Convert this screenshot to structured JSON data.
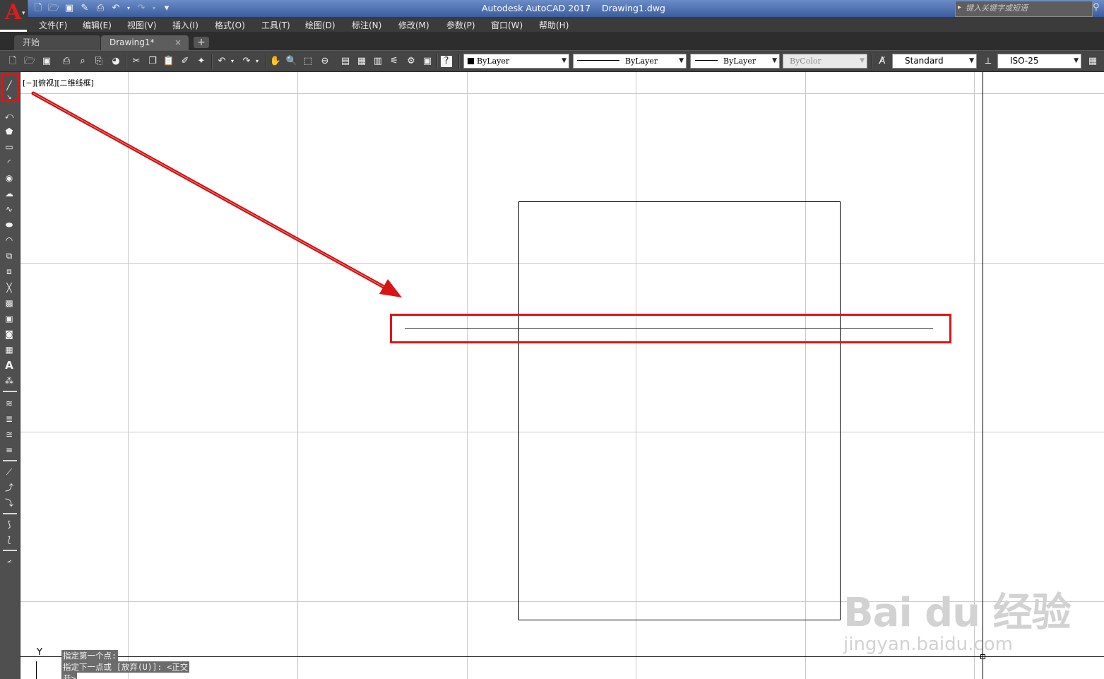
{
  "app": {
    "logo_letter": "A",
    "window_title": "Autodesk AutoCAD 2017    Drawing1.dwg",
    "search_placeholder": "键入关键字或短语"
  },
  "quick_access": [
    "new-icon",
    "open-icon",
    "save-icon",
    "save-as-icon",
    "plot-icon",
    "undo-icon",
    "redo-icon",
    "customize-icon"
  ],
  "menu": [
    "文件(F)",
    "编辑(E)",
    "视图(V)",
    "插入(I)",
    "格式(O)",
    "工具(T)",
    "绘图(D)",
    "标注(N)",
    "修改(M)",
    "参数(P)",
    "窗口(W)",
    "帮助(H)"
  ],
  "tabs": {
    "start": "开始",
    "drawing": "Drawing1*",
    "close": "×",
    "add": "+"
  },
  "toolbar": {
    "layer_color": "ByLayer",
    "linetype": "ByLayer",
    "lineweight": "ByLayer",
    "plot_style": "ByColor",
    "text_style": "Standard",
    "dim_style": "ISO-25"
  },
  "canvas": {
    "viewport_label": "[−][俯视][二维线框]",
    "ucs_y": "Y",
    "command_lines": [
      "指定第一个点:",
      "指定下一点或 [放弃(U)]: <正交",
      "开>"
    ]
  },
  "watermark": {
    "logo": "Bai du 经验",
    "sub": "jingyan.baidu.com"
  },
  "colors": {
    "highlight": "#e01414",
    "toolbar_bg": "#454545",
    "menu_bg": "#3b3b3b",
    "title_bg": "#3b5d9d"
  }
}
